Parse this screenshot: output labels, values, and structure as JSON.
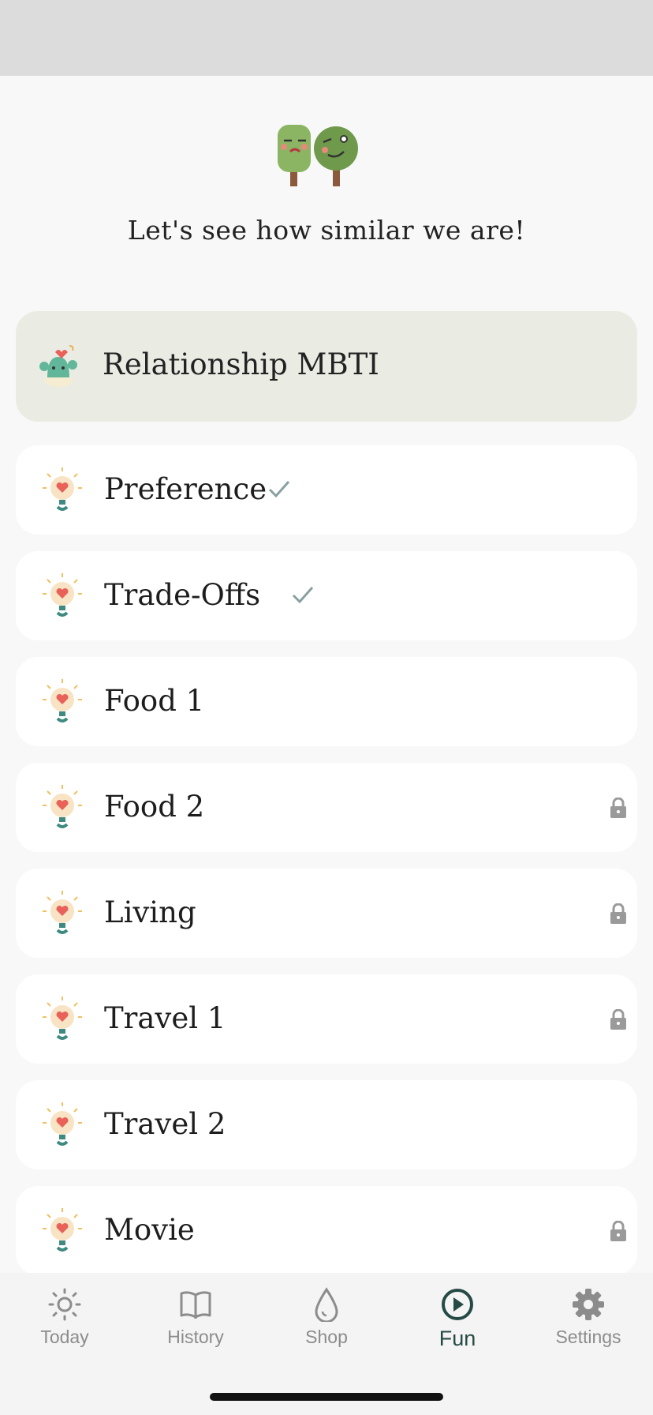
{
  "headline": "Let's see how similar we are!",
  "header_card": {
    "label": "Relationship MBTI",
    "icon": "cactus-icon"
  },
  "items": [
    {
      "title": "Preference",
      "status": "completed"
    },
    {
      "title": "Trade-Offs",
      "status": "completed"
    },
    {
      "title": "Food 1",
      "status": "available"
    },
    {
      "title": "Food 2",
      "status": "locked"
    },
    {
      "title": "Living",
      "status": "locked"
    },
    {
      "title": "Travel 1",
      "status": "locked"
    },
    {
      "title": "Travel 2",
      "status": "available"
    },
    {
      "title": "Movie",
      "status": "locked"
    }
  ],
  "tabs": [
    {
      "label": "Today",
      "icon": "sun-icon"
    },
    {
      "label": "History",
      "icon": "book-icon"
    },
    {
      "label": "Shop",
      "icon": "drop-icon"
    },
    {
      "label": "Fun",
      "icon": "play-circle-icon",
      "active": true
    },
    {
      "label": "Settings",
      "icon": "gear-icon"
    }
  ],
  "colors": {
    "accent": "#254a45",
    "header_card_bg": "#eaece4",
    "check": "#8aa0a0",
    "lock": "#9a9a9a"
  }
}
